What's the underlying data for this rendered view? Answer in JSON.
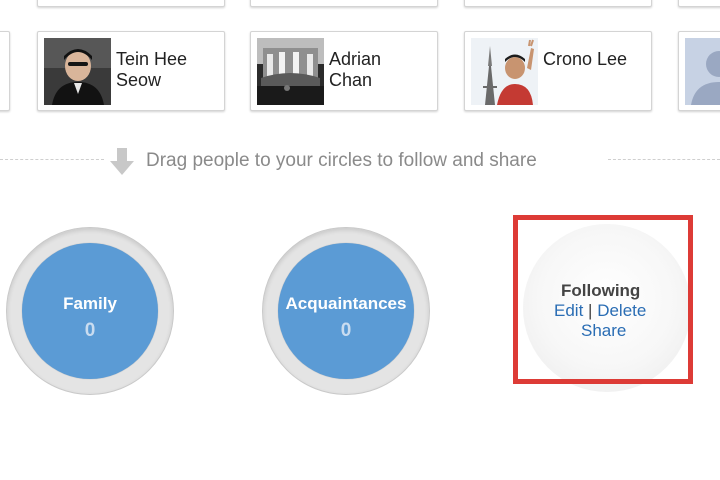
{
  "people": [
    {
      "name_line1": "Tein Hee",
      "name_line2": "Seow"
    },
    {
      "name_line1": "Adrian",
      "name_line2": "Chan"
    },
    {
      "name_line1": "Crono Lee",
      "name_line2": ""
    }
  ],
  "drag_hint": {
    "text": "Drag people to your circles to follow and share",
    "icon": "down-arrow-icon"
  },
  "circles": [
    {
      "name": "Family",
      "count": "0"
    },
    {
      "name": "Acquaintances",
      "count": "0"
    }
  ],
  "following": {
    "title": "Following",
    "edit_label": "Edit",
    "separator": "|",
    "delete_label": "Delete",
    "share_label": "Share"
  },
  "colors": {
    "circle_blue": "#5b9bd5",
    "link_blue": "#2a6db4",
    "highlight_red": "#dd3b36"
  }
}
